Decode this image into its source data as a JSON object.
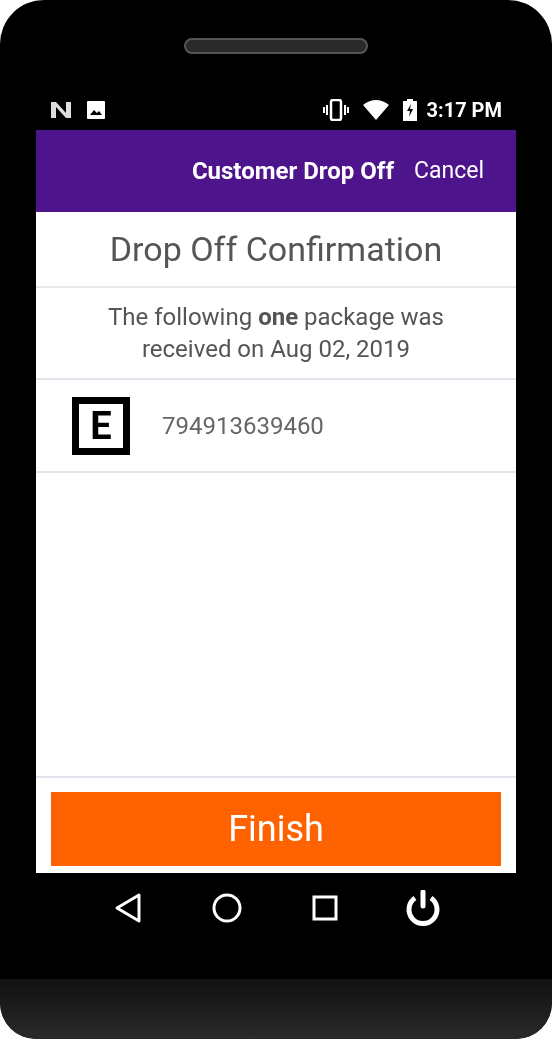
{
  "status_bar": {
    "time": "3:17 PM"
  },
  "app_bar": {
    "title": "Customer Drop Off",
    "action": "Cancel"
  },
  "heading": "Drop Off Confirmation",
  "message": "The following **one** package was received on Aug 02, 2019",
  "packages": [
    {
      "tracking_number": "794913639460",
      "badge": "E"
    }
  ],
  "finish_button": "Finish"
}
